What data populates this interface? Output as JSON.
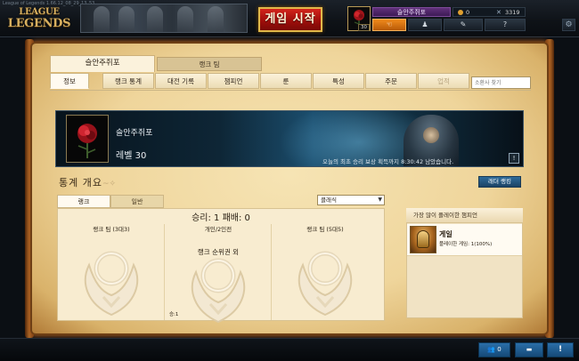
{
  "window": {
    "title": "League of Legends 1.66.12_08_29_13_53"
  },
  "logo": {
    "line1": "LEAGUE",
    "line2": "LEGENDS"
  },
  "play": {
    "label": "게임 시작"
  },
  "header": {
    "summoner_name": "슬안주쥐포",
    "level": "30",
    "ip": "0",
    "rp": "3319",
    "nav": {
      "shop": "☜",
      "profile": "♟",
      "store": "✎",
      "help": "?"
    },
    "settings_icon": "gear-icon"
  },
  "profile": {
    "tabs": [
      "슬안주쥐포",
      "랭크 팀"
    ],
    "subtabs": [
      "정보",
      "랭크 통계",
      "대전 기록",
      "챔피언",
      "룬",
      "특성",
      "주문",
      "업적"
    ],
    "search_placeholder": "소환사 찾기",
    "hero": {
      "name": "슬안주쥐포",
      "level_text": "레벨 30",
      "first_win": "오늘의 최초 승리 보상 획득까지 8:30:42 남았습니다.",
      "first_win_icon": "!"
    }
  },
  "stats": {
    "heading": "통계 개요",
    "ladder_button": "래더 랭킹",
    "types": [
      "랭크",
      "일반"
    ],
    "season": "클래식",
    "record": "승리: 1  패배: 0",
    "columns": [
      {
        "title": "랭크 팀 (3대3)"
      },
      {
        "title": "개인/2인전",
        "note": "랭크 순위권 외"
      },
      {
        "title": "랭크 팀 (5대5)"
      }
    ],
    "wins_label": "승:1"
  },
  "most_played": {
    "heading": "가장 많이 플레이한 챔피언",
    "champion": "게일",
    "games": "플레이한 게임: 1(100%)"
  },
  "bottom": {
    "friends": "0",
    "chat": "▬",
    "notifications": "!"
  },
  "colors": {
    "accent": "#d4241c",
    "parchment": "#f6e4b4",
    "button_blue": "#2a6ea8",
    "summoner_bar": "#61317b"
  }
}
